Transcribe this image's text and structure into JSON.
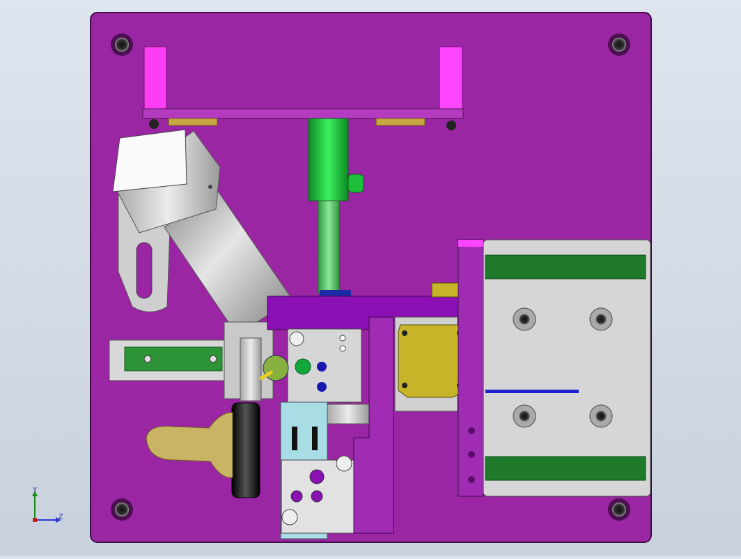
{
  "viewport": {
    "background": "#d5dce6",
    "axes": {
      "y_label": "Y",
      "z_label": "Z"
    }
  },
  "colors": {
    "base_plate": "#9b26a4",
    "base_edge": "#4b1350",
    "magenta_block": "#ff40ff",
    "green_rod": "#18c43a",
    "green_rail": "#2a8a2a",
    "gray_part": "#d0d0d0",
    "yellow_part": "#c8b428",
    "cyan_part": "#a8e0e8",
    "violet_bar": "#8a10b4",
    "tan_part": "#c8b464",
    "blue_line": "#2020d0",
    "dark_handle": "#1a1a1a"
  },
  "model": {
    "components": [
      "base-plate",
      "top-bracket",
      "left-magenta-block",
      "right-magenta-block",
      "cylinder-body",
      "cylinder-rod",
      "angled-actuator",
      "actuator-cap",
      "left-linear-rail",
      "cross-bar",
      "center-block",
      "yellow-motor-plate",
      "right-slide-unit",
      "right-green-rail-top",
      "right-green-rail-bottom",
      "cyan-slide",
      "lower-gray-block",
      "tan-lever",
      "black-handle",
      "vertical-purple-bar"
    ]
  }
}
